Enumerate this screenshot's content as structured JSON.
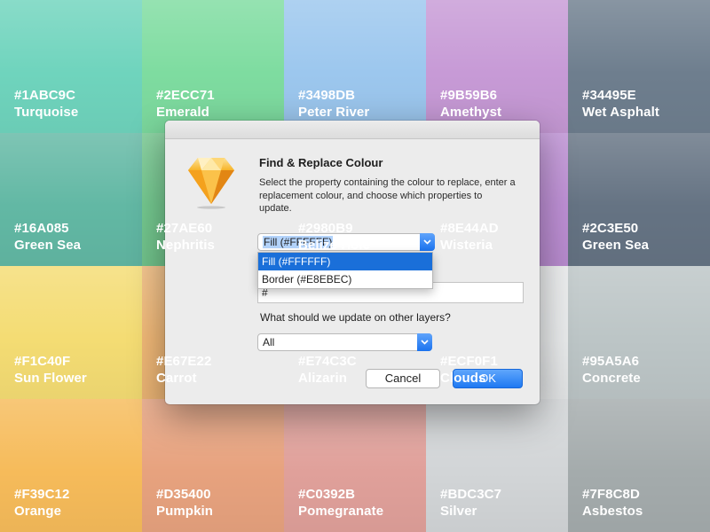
{
  "swatches": [
    {
      "hex": "#1ABC9C",
      "name": "Turquoise",
      "color": "#6fd4bd"
    },
    {
      "hex": "#2ECC71",
      "name": "Emerald",
      "color": "#7edca0"
    },
    {
      "hex": "#3498DB",
      "name": "Peter River",
      "color": "#9cc7ee"
    },
    {
      "hex": "#9B59B6",
      "name": "Amethyst",
      "color": "#c79ad6"
    },
    {
      "hex": "#34495E",
      "name": "Wet Asphalt",
      "color": "#6e7e8e"
    },
    {
      "hex": "#16A085",
      "name": "Green Sea",
      "color": "#62b8a4"
    },
    {
      "hex": "#27AE60",
      "name": "Nephritis",
      "color": "#74c88f"
    },
    {
      "hex": "#2980B9",
      "name": "Belize Hole",
      "color": "#84b1d6"
    },
    {
      "hex": "#8E44AD",
      "name": "Wisteria",
      "color": "#bd8fd4"
    },
    {
      "hex": "#2C3E50",
      "name": "Green Sea",
      "color": "#657383"
    },
    {
      "hex": "#F1C40F",
      "name": "Sun Flower",
      "color": "#f4dc73"
    },
    {
      "hex": "#E67E22",
      "name": "Carrot",
      "color": "#f0b877"
    },
    {
      "hex": "#E74C3C",
      "name": "Alizarin",
      "color": "#ef9f96"
    },
    {
      "hex": "#ECF0F1",
      "name": "Clouds",
      "color": "#e8eaeb"
    },
    {
      "hex": "#95A5A6",
      "name": "Concrete",
      "color": "#bcc5c6"
    },
    {
      "hex": "#F39C12",
      "name": "Orange",
      "color": "#f6bb5a"
    },
    {
      "hex": "#D35400",
      "name": "Pumpkin",
      "color": "#e7a27e"
    },
    {
      "hex": "#C0392B",
      "name": "Pomegranate",
      "color": "#e0a09a"
    },
    {
      "hex": "#BDC3C7",
      "name": "Silver",
      "color": "#d2d5d7"
    },
    {
      "hex": "#7F8C8D",
      "name": "Asbestos",
      "color": "#a4abac"
    }
  ],
  "dialog": {
    "title": "Find & Replace Colour",
    "description": "Select the property containing the colour to replace, enter a replacement colour, and choose which properties to update.",
    "property_select": {
      "value": "Fill (#FFFFFF)",
      "options": [
        "Fill (#FFFFFF)",
        "Border (#E8EBEC)"
      ]
    },
    "replacement_field": {
      "value": "#"
    },
    "question": "What should we update on other layers?",
    "update_select": {
      "value": "All"
    },
    "cancel_label": "Cancel",
    "ok_label": "OK",
    "icon": "sketch-diamond-icon",
    "accent": "#1b73ef"
  }
}
